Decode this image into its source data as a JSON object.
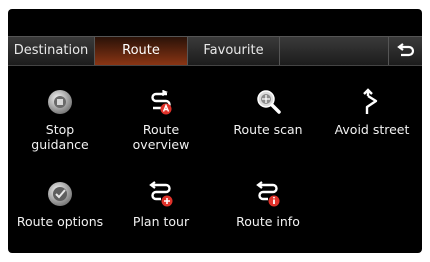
{
  "tabs": [
    {
      "label": "Destination",
      "active": false
    },
    {
      "label": "Route",
      "active": true
    },
    {
      "label": "Favourite",
      "active": false
    }
  ],
  "back_icon": "return-arrow-icon",
  "menu": {
    "stop_guidance": {
      "line1": "Stop",
      "line2": "guidance",
      "icon": "stop-disc-icon"
    },
    "route_overview": {
      "line1": "Route",
      "line2": "overview",
      "icon": "route-flag-icon"
    },
    "route_scan": {
      "label": "Route scan",
      "icon": "magnifier-icon"
    },
    "avoid_street": {
      "label": "Avoid street",
      "icon": "detour-arrow-icon"
    },
    "route_options": {
      "label": "Route options",
      "icon": "checkmark-disc-icon"
    },
    "plan_tour": {
      "label": "Plan tour",
      "icon": "route-plus-icon"
    },
    "route_info": {
      "label": "Route info",
      "icon": "route-info-icon"
    }
  },
  "colors": {
    "background": "#000000",
    "active_tab": "#8a3514",
    "accent_red": "#e0322a",
    "text": "#f2f2f2"
  }
}
